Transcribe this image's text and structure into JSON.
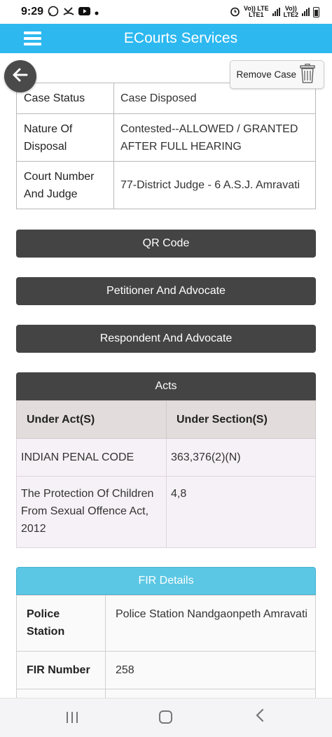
{
  "status_bar": {
    "time": "9:29",
    "sim1_top": "Vo)) LTE",
    "sim1_bottom": "LTE1",
    "sim2_top": "Vo))",
    "sim2_bottom": "LTE2"
  },
  "app_bar": {
    "title": "ECourts Services"
  },
  "actions": {
    "remove_label": "Remove Case"
  },
  "case_details": [
    {
      "key": "Case Status",
      "value": "Case Disposed"
    },
    {
      "key": "Nature Of Disposal",
      "value": "Contested--ALLOWED / GRANTED AFTER FULL HEARING"
    },
    {
      "key": "Court Number And Judge",
      "value": "77-District Judge - 6 A.S.J. Amravati"
    }
  ],
  "buttons": {
    "qr_code": "QR Code",
    "petitioner": "Petitioner And Advocate",
    "respondent": "Respondent And Advocate"
  },
  "acts": {
    "title": "Acts",
    "headers": [
      "Under Act(S)",
      "Under Section(S)"
    ],
    "rows": [
      {
        "act": "INDIAN PENAL CODE",
        "section": "363,376(2)(N)"
      },
      {
        "act": "The Protection Of Children From Sexual Offence Act, 2012",
        "section": "4,8"
      }
    ]
  },
  "fir": {
    "title": "FIR Details",
    "rows": [
      {
        "key": "Police Station",
        "value": "Police Station Nandgaonpeth Amravati"
      },
      {
        "key": "FIR Number",
        "value": "258"
      }
    ]
  },
  "icons": {
    "back": "arrow-left-icon",
    "remove": "trash-icon",
    "menu": "hamburger-icon"
  },
  "colors": {
    "app_bar": "#2db8f0",
    "dark_button": "#444444",
    "fir_header": "#5bc7e4"
  }
}
